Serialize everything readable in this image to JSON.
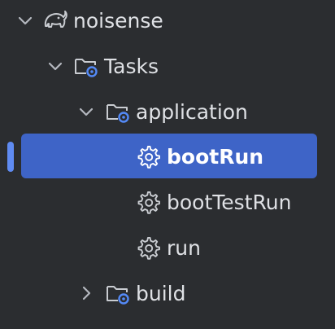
{
  "tree": {
    "root": {
      "label": "noisense",
      "icon": "gradle-elephant-icon"
    },
    "tasks": {
      "label": "Tasks",
      "icon": "task-folder-icon"
    },
    "application": {
      "label": "application",
      "icon": "task-folder-icon"
    },
    "items": [
      {
        "label": "bootRun",
        "icon": "gear-icon",
        "selected": true
      },
      {
        "label": "bootTestRun",
        "icon": "gear-icon",
        "selected": false
      },
      {
        "label": "run",
        "icon": "gear-icon",
        "selected": false
      }
    ],
    "build": {
      "label": "build",
      "icon": "task-folder-icon",
      "expanded": false
    }
  },
  "colors": {
    "background": "#2b2d30",
    "selection": "#3e64c7",
    "focus_bar": "#5f8bf2",
    "text": "#dfe1e5",
    "accent_blue": "#548af7"
  }
}
